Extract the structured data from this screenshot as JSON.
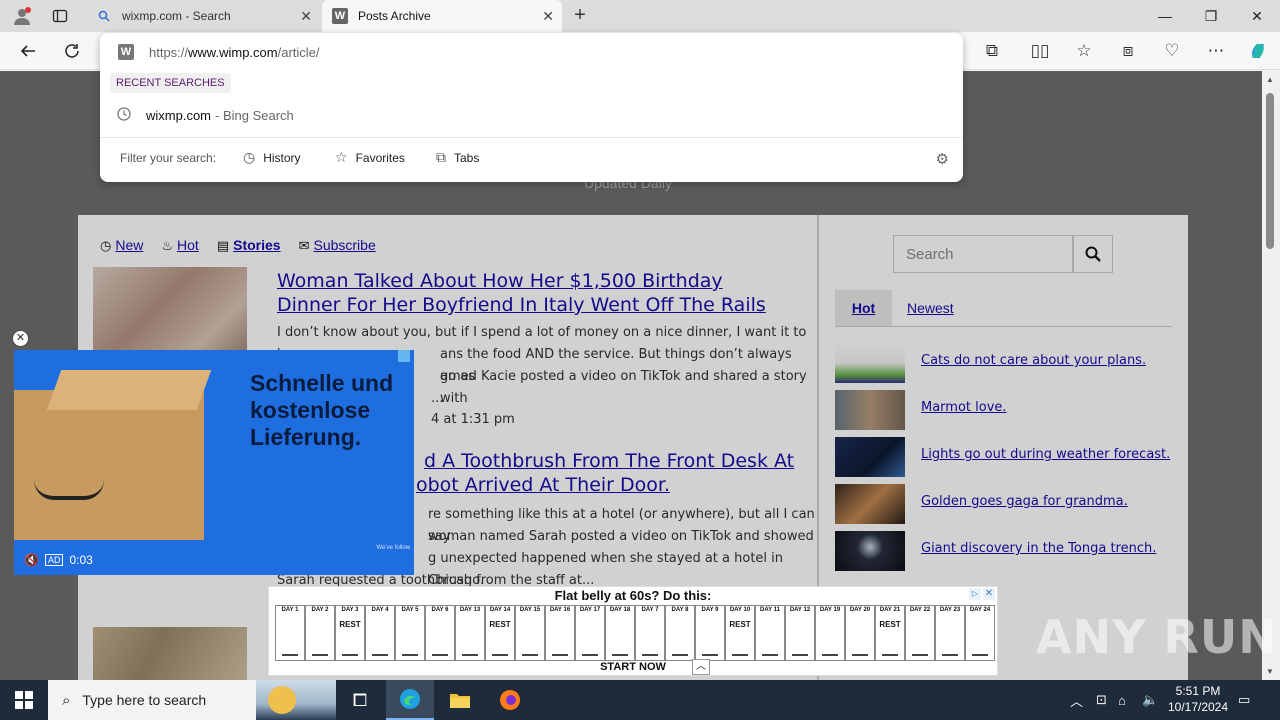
{
  "browser": {
    "tabs": [
      {
        "title": "wixmp.com - Search",
        "favicon": "search-icon",
        "active": false
      },
      {
        "title": "Posts Archive",
        "favicon": "W",
        "active": true
      }
    ],
    "omnibox": {
      "url_scheme": "https://",
      "url_domain": "www.wimp.com",
      "url_path": "/article/",
      "recent_label": "RECENT SEARCHES",
      "suggestion_query": "wixmp.com",
      "suggestion_source": "- Bing Search",
      "filter_label": "Filter your search:",
      "filters": [
        "History",
        "Favorites",
        "Tabs"
      ]
    }
  },
  "page": {
    "tagline": "Updated Daily",
    "nav": {
      "new": "New",
      "hot": "Hot",
      "stories": "Stories",
      "subscribe": "Subscribe"
    },
    "articles": [
      {
        "title": "Woman Talked About How Her $1,500 Birthday Dinner For Her Boyfriend In Italy Went Off The Rails",
        "line1": "I don’t know about you, but if I spend a lot of money on a nice dinner, I want it to be",
        "line2": "ans the food AND the service. But things don’t always go as",
        "line3": "amed Kacie posted a video on TikTok and shared a story with",
        "line4": "...",
        "date": "4 at 1:31 pm"
      },
      {
        "title_part1": "d A Toothbrush From The Front Desk At",
        "title_part2": "obot Arrived At Their Door.",
        "line1": "re something like this at a hotel (or anywhere), but all I can say",
        "line2": "woman named Sarah posted a video on TikTok and showed",
        "line3": "g unexpected happened when she stayed at a hotel in Chicago.",
        "line4": "Sarah requested a toothbrush from the staff at..."
      }
    ],
    "sidebar": {
      "search_placeholder": "Search",
      "tab_hot": "Hot",
      "tab_newest": "Newest",
      "items": [
        "Cats do not care about your plans.",
        "Marmot love.",
        "Lights go out during weather forecast.",
        "Golden goes gaga for grandma.",
        "Giant discovery in the Tonga trench."
      ]
    }
  },
  "video_ad": {
    "headline": "Schnelle und kostenlose Lieferung.",
    "time": "0:03",
    "ad_label": "AD",
    "small_text": "We’ve follow"
  },
  "banner_ad": {
    "title": "Flat belly at 60s? Do this:",
    "cta": "START NOW",
    "days": [
      "DAY 1",
      "DAY 2",
      "DAY 3",
      "DAY 4",
      "DAY 5",
      "DAY 6",
      "DAY 13",
      "DAY 14",
      "DAY 15",
      "DAY 16",
      "DAY 17",
      "DAY 18",
      "DAY 7",
      "DAY 8",
      "DAY 9",
      "DAY 10",
      "DAY 11",
      "DAY 12",
      "DAY 19",
      "DAY 20",
      "DAY 21",
      "DAY 22",
      "DAY 23",
      "DAY 24"
    ],
    "rest_label": "REST"
  },
  "watermark": "ANY RUN",
  "taskbar": {
    "search_placeholder": "Type here to search",
    "time": "5:51 PM",
    "date": "10/17/2024"
  },
  "colors": {
    "link": "#1a0dab",
    "ad_blue": "#1f6ee0",
    "taskbar": "#1e2b3a"
  }
}
